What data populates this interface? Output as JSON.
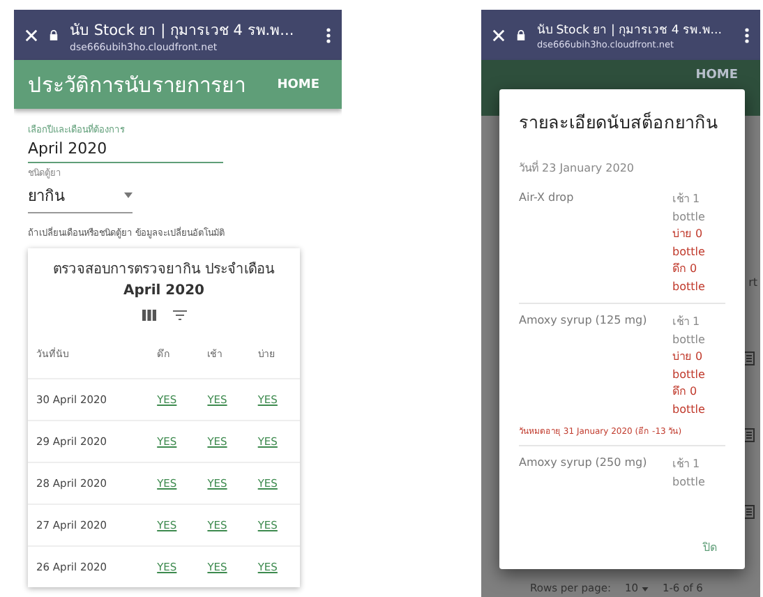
{
  "left_phone": {
    "browser_bar": {
      "title": "นับ Stock ยา | กุมารเวช 4 รพ.พ...",
      "url": "dse666ubih3ho.cloudfront.net"
    },
    "app_bar": {
      "title": "ประวัติการนับรายการยา",
      "action": "HOME"
    },
    "month_field": {
      "label": "เลือกปีและเดือนที่ต้องการ",
      "value": "April 2020"
    },
    "cabinet_select": {
      "label": "ชนิดตู้ยา",
      "value": "ยากิน"
    },
    "hint": "ถ้าเปลี่ยนเดือนหรือชนิดตู้ยา ข้อมูลจะเปลี่ยนอัตโนมัติ",
    "table": {
      "title": "ตรวจสอบการตรวจยากิน ประจำเดือน **April 2020**",
      "columns": [
        "วันที่นับ",
        "ดึก",
        "เช้า",
        "บ่าย"
      ],
      "rows": [
        {
          "cells": [
            "30 April 2020",
            "YES",
            "YES",
            "YES"
          ]
        },
        {
          "cells": [
            "29 April 2020",
            "YES",
            "YES",
            "YES"
          ]
        },
        {
          "cells": [
            "28 April 2020",
            "YES",
            "YES",
            "YES"
          ]
        },
        {
          "cells": [
            "27 April 2020",
            "YES",
            "YES",
            "YES"
          ]
        },
        {
          "cells": [
            "26 April 2020",
            "YES",
            "YES",
            "YES"
          ]
        }
      ]
    }
  },
  "right_phone": {
    "browser_bar": {
      "title": "นับ Stock ยา | กุมารเวช 4 รพ.พ...",
      "url": "dse666ubih3ho.cloudfront.net"
    },
    "background": {
      "app_bar": {
        "action": "HOME"
      },
      "column_cut": "rt",
      "footer": {
        "rows_label": "Rows per page:",
        "rows_value": "10",
        "range": "1-6 of 6"
      }
    },
    "dialog": {
      "title": "รายละเอียดนับสต็อกยากิน",
      "date": "วันที่ 23 January 2020",
      "items": [
        {
          "name": "Air-X drop",
          "counts": [
            {
              "text": "เช้า 1 bottle",
              "alert": false
            },
            {
              "text": "บ่าย 0 bottle",
              "alert": true
            },
            {
              "text": "ดึก 0 bottle",
              "alert": true
            }
          ]
        },
        {
          "name": "Amoxy syrup (125 mg)",
          "counts": [
            {
              "text": "เช้า 1 bottle",
              "alert": false
            },
            {
              "text": "บ่าย 0 bottle",
              "alert": true
            },
            {
              "text": "ดึก 0 bottle",
              "alert": true
            }
          ],
          "expiry": "วันหมดอายุ 31 January 2020 (อีก -13 วัน)"
        },
        {
          "name": "Amoxy syrup (250 mg)",
          "counts": [
            {
              "text": "เช้า 1 bottle",
              "alert": false
            }
          ]
        }
      ],
      "close": "ปิด"
    }
  }
}
